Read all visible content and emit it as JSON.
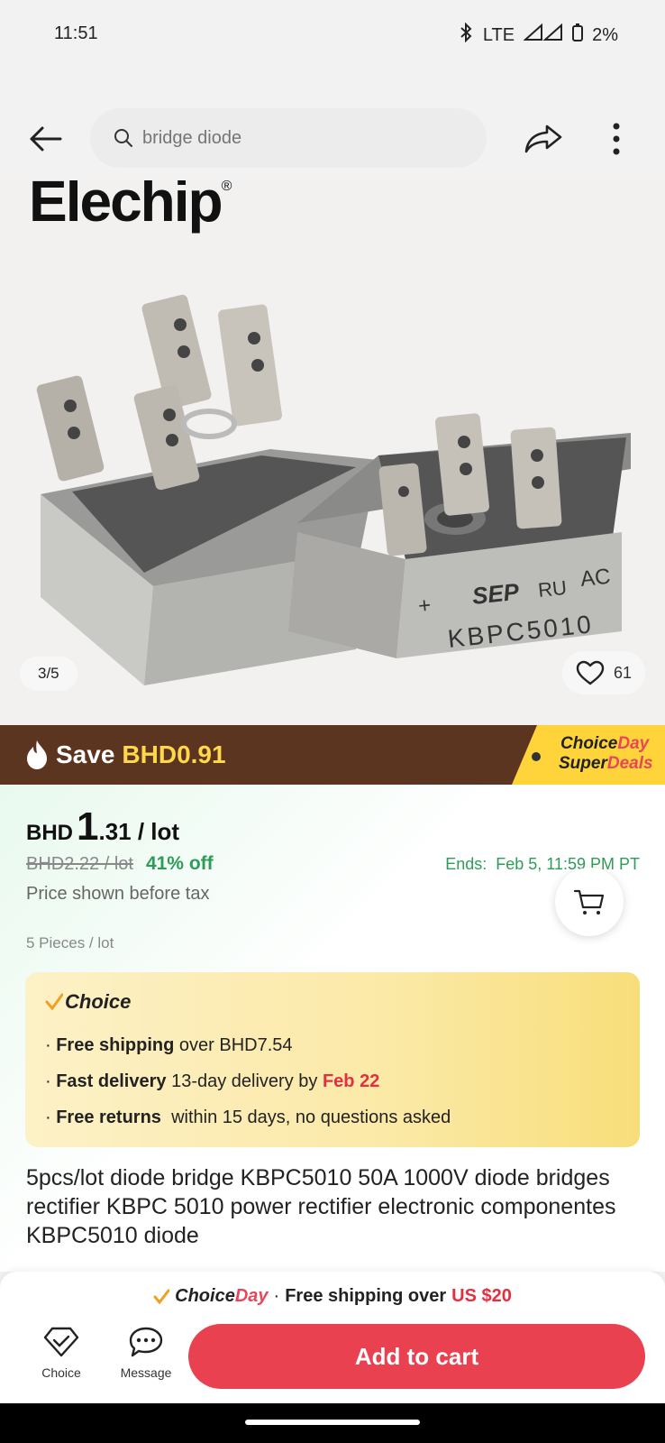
{
  "status_bar": {
    "time": "11:51",
    "network": "LTE",
    "battery": "2%"
  },
  "search": {
    "placeholder": "bridge diode"
  },
  "product_image": {
    "brand": "Elechip",
    "counter": "3/5",
    "favorites_count": "61",
    "part_marking": "KBPC5010"
  },
  "promo": {
    "save_label": "Save",
    "save_amount": "BHD0.91",
    "tag_line1_a": "Choice",
    "tag_line1_b": "Day",
    "tag_line2_a": "Super",
    "tag_line2_b": "Deals"
  },
  "price": {
    "currency": "BHD",
    "integer": "1",
    "decimal_unit": ".31 / lot",
    "original": "BHD2.22 / lot",
    "discount": "41% off",
    "ends_label": "Ends:",
    "ends_value": "Feb 5, 11:59 PM PT",
    "tax_note": "Price shown before tax",
    "lot_size": "5 Pieces / lot"
  },
  "choice_card": {
    "title": "Choice",
    "line1_bold": "Free shipping",
    "line1_rest": "over BHD7.54",
    "line2_bold": "Fast delivery",
    "line2_rest": "13-day delivery by",
    "line2_date": "Feb 22",
    "line3_bold": "Free returns",
    "line3_rest": "within 15 days, no questions asked"
  },
  "product_title": "5pcs/lot diode bridge KBPC5010 50A 1000V diode bridges rectifier KBPC 5010 power rectifier electronic componentes KBPC5010 diode",
  "bottom": {
    "banner_brand_a": "Choice",
    "banner_brand_b": "Day",
    "banner_text": "Free shipping over",
    "banner_amount": "US $20",
    "nav_choice": "Choice",
    "nav_message": "Message",
    "add_to_cart": "Add to cart"
  },
  "colors": {
    "accent_red": "#e9414f",
    "discount_green": "#2e9c59",
    "promo_brown": "#5c3520",
    "promo_yellow": "#ffd84a"
  }
}
